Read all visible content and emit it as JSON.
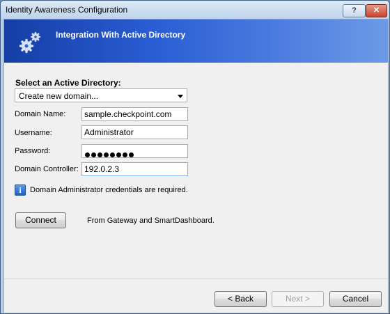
{
  "window": {
    "title": "Identity Awareness Configuration",
    "help_label": "?",
    "close_label": "✕"
  },
  "banner": {
    "icon": "gears-icon",
    "title": "Integration With Active Directory"
  },
  "form": {
    "select_label": "Select an Active Directory:",
    "directory_select_value": "Create new domain...",
    "domain_name_label": "Domain Name:",
    "domain_name_value": "sample.checkpoint.com",
    "username_label": "Username:",
    "username_value": "Administrator",
    "password_label": "Password:",
    "password_length": 8,
    "domain_controller_label": "Domain Controller:",
    "domain_controller_value": "192.0.2.3",
    "info_icon": "info-icon",
    "info_icon_glyph": "i",
    "info_text": "Domain Administrator credentials are required.",
    "connect_label": "Connect",
    "connect_note": "From Gateway and SmartDashboard."
  },
  "footer": {
    "back_label": "< Back",
    "next_label": "Next >",
    "cancel_label": "Cancel"
  },
  "colors": {
    "banner_start": "#153ea6",
    "banner_end": "#6d9ae6",
    "close_button": "#c8442c"
  }
}
